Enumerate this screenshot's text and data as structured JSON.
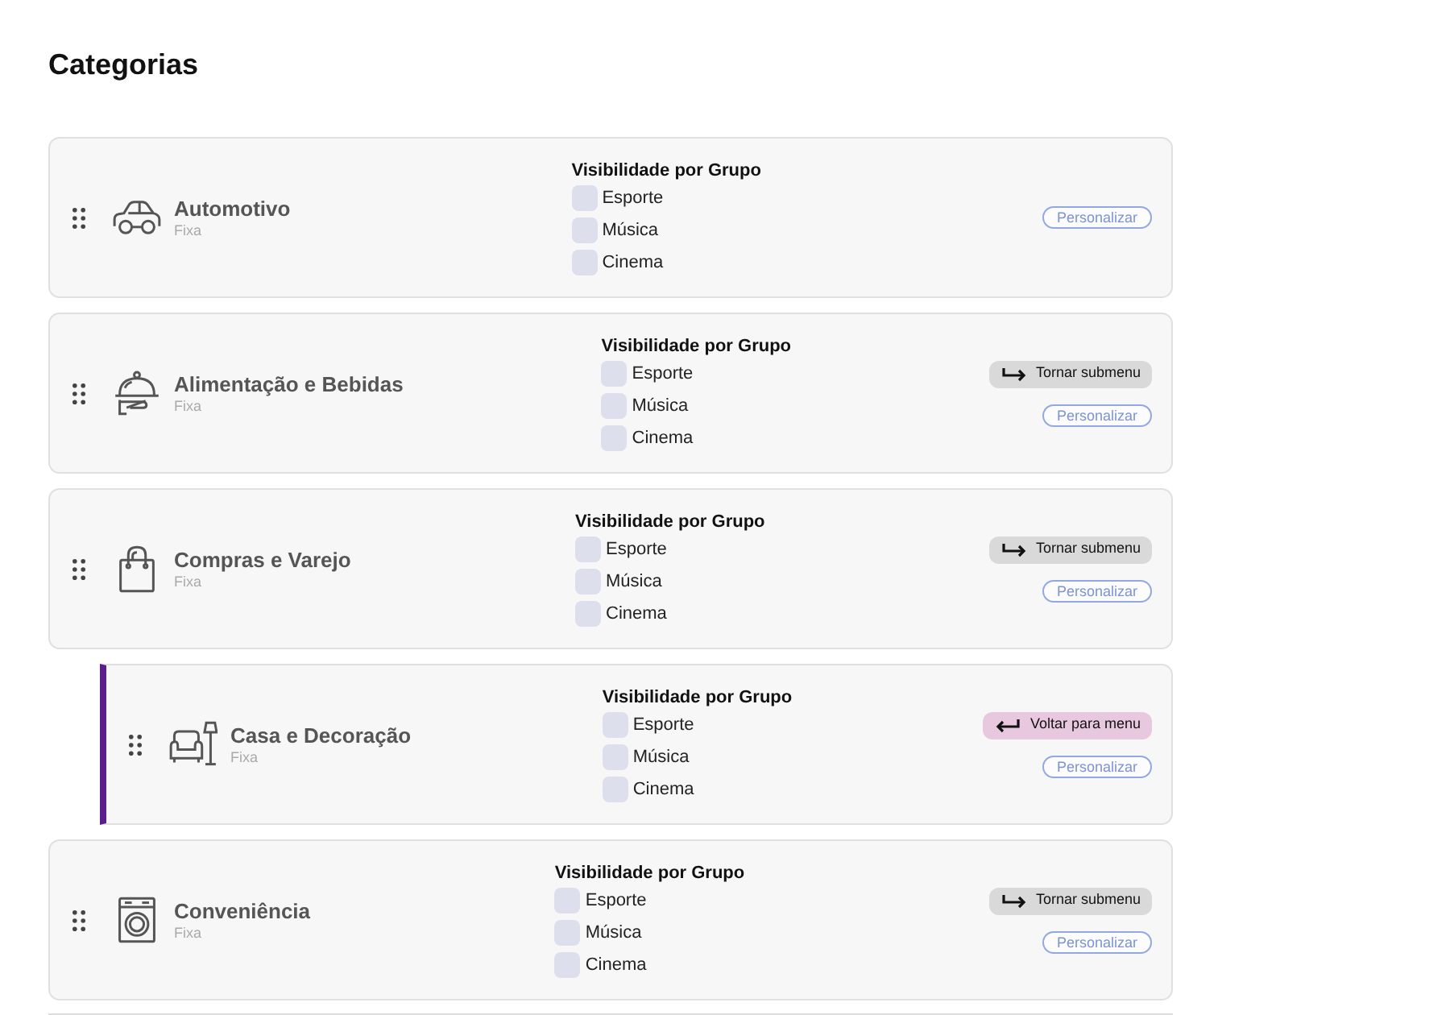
{
  "page": {
    "title": "Categorias"
  },
  "categories": [
    {
      "name": "Automotivo",
      "type": "Fixa",
      "submenu": false,
      "visibility": {
        "title": "Visibilidade por Grupo",
        "groups": [
          {
            "label": "Esporte",
            "checked": false
          },
          {
            "label": "Música",
            "checked": false
          },
          {
            "label": "Cinema",
            "checked": false
          }
        ]
      },
      "actions": [
        {
          "kind": "customize",
          "label": "Personalizar"
        }
      ]
    },
    {
      "name": "Alimentação e Bebidas",
      "type": "Fixa",
      "submenu": false,
      "visibility": {
        "title": "Visibilidade por Grupo",
        "groups": [
          {
            "label": "Esporte",
            "checked": false
          },
          {
            "label": "Música",
            "checked": false
          },
          {
            "label": "Cinema",
            "checked": false
          }
        ]
      },
      "actions": [
        {
          "kind": "make_submenu",
          "label": "Tornar submenu"
        },
        {
          "kind": "customize",
          "label": "Personalizar"
        }
      ]
    },
    {
      "name": "Compras e Varejo",
      "type": "Fixa",
      "submenu": false,
      "visibility": {
        "title": "Visibilidade por Grupo",
        "groups": [
          {
            "label": "Esporte",
            "checked": false
          },
          {
            "label": "Música",
            "checked": false
          },
          {
            "label": "Cinema",
            "checked": false
          }
        ]
      },
      "actions": [
        {
          "kind": "make_submenu",
          "label": "Tornar submenu"
        },
        {
          "kind": "customize",
          "label": "Personalizar"
        }
      ]
    },
    {
      "name": "Casa e Decoração",
      "type": "Fixa",
      "submenu": true,
      "visibility": {
        "title": "Visibilidade por Grupo",
        "groups": [
          {
            "label": "Esporte",
            "checked": false
          },
          {
            "label": "Música",
            "checked": false
          },
          {
            "label": "Cinema",
            "checked": false
          }
        ]
      },
      "actions": [
        {
          "kind": "back_to_menu",
          "label": "Voltar para menu"
        },
        {
          "kind": "customize",
          "label": "Personalizar"
        }
      ]
    },
    {
      "name": "Conveniência",
      "type": "Fixa",
      "submenu": false,
      "visibility": {
        "title": "Visibilidade por Grupo",
        "groups": [
          {
            "label": "Esporte",
            "checked": false
          },
          {
            "label": "Música",
            "checked": false
          },
          {
            "label": "Cinema",
            "checked": false
          }
        ]
      },
      "actions": [
        {
          "kind": "make_submenu",
          "label": "Tornar submenu"
        },
        {
          "kind": "customize",
          "label": "Personalizar"
        }
      ]
    }
  ]
}
